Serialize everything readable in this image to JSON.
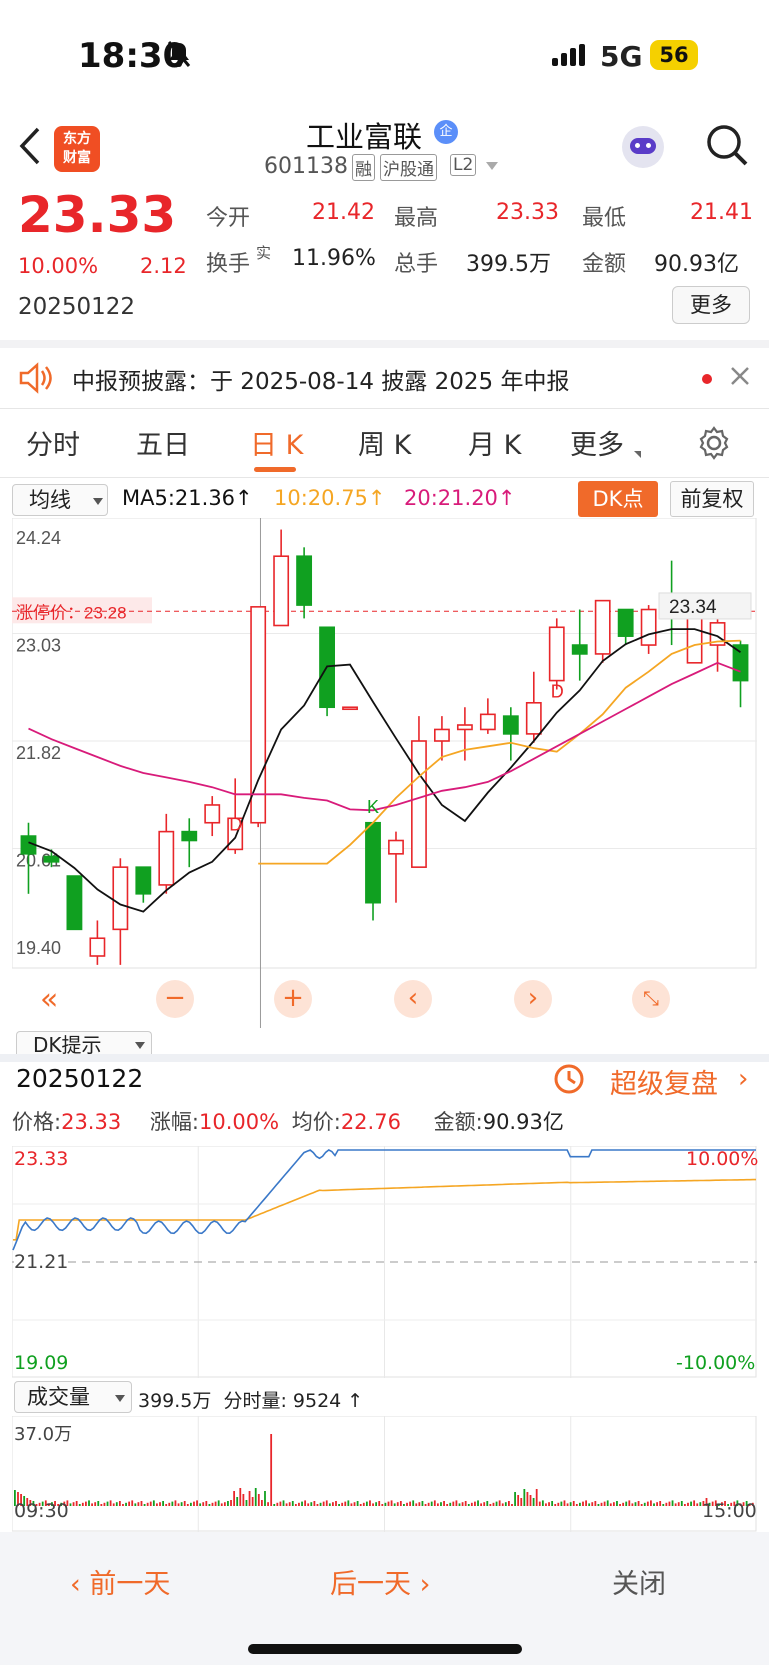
{
  "status": {
    "time": "18:30",
    "network": "5G",
    "battery": "56"
  },
  "header": {
    "logo_line1": "东方",
    "logo_line2": "财富",
    "stock_name": "工业富联",
    "name_badge": "企",
    "stock_code": "601138",
    "tag_margin": "融",
    "tag_connect": "沪股通",
    "tag_level": "L2"
  },
  "quote": {
    "price": "23.33",
    "change_pct": "10.00%",
    "change": "2.12",
    "date": "20250122",
    "open_label": "今开",
    "open": "21.42",
    "high_label": "最高",
    "high": "23.33",
    "low_label": "最低",
    "low": "21.41",
    "turnover_label": "换手",
    "turnover_sup": "实",
    "turnover": "11.96%",
    "volume_label": "总手",
    "volume": "399.5万",
    "amount_label": "金额",
    "amount": "90.93亿",
    "more": "更多"
  },
  "notice": {
    "text": "中报预披露：于 2025-08-14 披露 2025 年中报"
  },
  "tabs": [
    "分时",
    "五日",
    "日 K",
    "周 K",
    "月 K",
    "更多"
  ],
  "active_tab": 2,
  "kline": {
    "ma_select": "均线",
    "ma5": "MA5:21.36",
    "ma10": "10:20.75",
    "ma20": "20:21.20",
    "dk_point": "DK点",
    "adjust": "前复权",
    "limit_label": "涨停价：23.28",
    "ticks": [
      "24.24",
      "23.03",
      "21.82",
      "20.61",
      "19.40"
    ],
    "last_price_tag": "23.34",
    "marks": [
      "D",
      "K",
      "D"
    ],
    "dk_hint": "DK提示",
    "colors": {
      "up": "#e8262a",
      "down": "#10a020",
      "ma5": "#111111",
      "ma10": "#f5a623",
      "ma20": "#d81b7a"
    }
  },
  "intraday": {
    "date": "20250122",
    "replay": "超级复盘",
    "price_label": "价格:",
    "price": "23.33",
    "pct_label": "涨幅:",
    "pct": "10.00%",
    "avg_label": "均价:",
    "avg": "22.76",
    "amount_label": "金额:",
    "amount": "90.93亿",
    "top": "23.33",
    "mid": "21.21",
    "bottom": "19.09",
    "top_pct": "10.00%",
    "bottom_pct": "-10.00%",
    "vol_select": "成交量",
    "vol_total": "399.5万",
    "vol_tick_label": "分时量:",
    "vol_tick": "9524",
    "vol_max": "37.0万",
    "time_start": "09:30",
    "time_end": "15:00"
  },
  "bottom_nav": {
    "prev": "前一天",
    "next": "后一天",
    "close": "关闭"
  },
  "chart_data": {
    "type": "candlestick",
    "ohlc": [
      [
        20.75,
        20.55,
        20.9,
        20.1
      ],
      [
        20.52,
        20.46,
        20.6,
        20.4
      ],
      [
        20.3,
        19.7,
        20.3,
        19.7
      ],
      [
        19.4,
        19.6,
        19.8,
        19.3
      ],
      [
        19.7,
        20.4,
        20.5,
        19.3
      ],
      [
        20.4,
        20.1,
        20.4,
        20.0
      ],
      [
        20.2,
        20.8,
        21.0,
        20.1
      ],
      [
        20.8,
        20.7,
        20.95,
        20.4
      ],
      [
        20.9,
        21.1,
        21.2,
        20.75
      ],
      [
        20.6,
        20.95,
        21.4,
        20.55
      ],
      [
        20.9,
        23.33,
        23.33,
        20.85
      ],
      [
        23.12,
        23.9,
        24.2,
        23.9
      ],
      [
        23.9,
        23.35,
        24.0,
        23.2
      ],
      [
        23.1,
        22.2,
        23.1,
        22.1
      ],
      [
        22.2,
        22.2,
        22.2,
        22.2
      ],
      [
        20.9,
        20.0,
        20.9,
        19.8
      ],
      [
        20.55,
        20.7,
        20.8,
        20.0
      ],
      [
        20.4,
        21.82,
        22.1,
        20.4
      ],
      [
        21.82,
        21.95,
        22.1,
        21.6
      ],
      [
        21.95,
        22.0,
        22.2,
        21.6
      ],
      [
        21.95,
        22.12,
        22.3,
        21.9
      ],
      [
        22.1,
        21.9,
        22.2,
        21.6
      ],
      [
        21.9,
        22.25,
        22.6,
        21.8
      ],
      [
        22.5,
        23.1,
        23.2,
        22.4
      ],
      [
        22.9,
        22.8,
        23.3,
        22.5
      ],
      [
        22.8,
        23.4,
        23.4,
        22.7
      ],
      [
        23.3,
        23.0,
        23.3,
        22.9
      ],
      [
        22.9,
        23.3,
        23.35,
        22.8
      ],
      [
        23.4,
        23.22,
        23.85,
        22.9
      ],
      [
        22.7,
        23.28,
        23.35,
        22.7
      ],
      [
        22.9,
        23.15,
        23.2,
        22.6
      ],
      [
        22.9,
        22.5,
        22.95,
        22.2
      ]
    ],
    "ma5": [
      20.68,
      20.58,
      20.39,
      20.15,
      19.98,
      19.9,
      20.14,
      20.34,
      20.46,
      20.73,
      21.38,
      21.95,
      22.22,
      22.66,
      22.68,
      22.26,
      21.85,
      21.45,
      21.1,
      20.92,
      21.24,
      21.52,
      21.82,
      22.14,
      22.39,
      22.72,
      22.91,
      23.02,
      23.08,
      23.08,
      23.0,
      22.82
    ],
    "ma10": [
      null,
      null,
      null,
      null,
      null,
      null,
      null,
      null,
      null,
      null,
      20.44,
      20.44,
      20.44,
      20.44,
      20.65,
      20.9,
      21.18,
      21.42,
      21.64,
      21.72,
      21.76,
      21.8,
      21.74,
      21.7,
      21.9,
      22.12,
      22.42,
      22.6,
      22.8,
      22.9,
      22.94,
      22.95
    ],
    "ma20": [
      21.96,
      21.84,
      21.74,
      21.64,
      21.54,
      21.46,
      21.41,
      21.36,
      21.3,
      21.22,
      21.22,
      21.22,
      21.18,
      21.15,
      21.05,
      21.04,
      21.1,
      21.18,
      21.26,
      21.3,
      21.36,
      21.48,
      21.62,
      21.76,
      21.9,
      22.04,
      22.18,
      22.32,
      22.46,
      22.58,
      22.7,
      22.6
    ],
    "ylim": [
      19.4,
      24.24
    ]
  }
}
